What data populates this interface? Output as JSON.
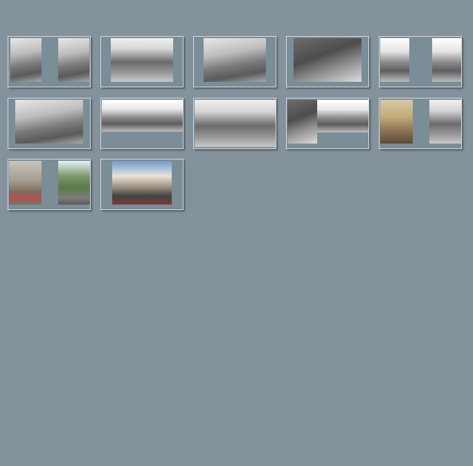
{
  "gallery": {
    "thumbnails": [
      {
        "caption": "",
        "palette": "bw"
      },
      {
        "caption": "",
        "palette": "bw2"
      },
      {
        "caption": "",
        "palette": "bw"
      },
      {
        "caption": "",
        "palette": "bw3"
      },
      {
        "caption": "",
        "palette": "bw4"
      },
      {
        "caption": "",
        "palette": "bw"
      },
      {
        "caption": "",
        "palette": "bw4"
      },
      {
        "caption": "",
        "palette": "bw2"
      },
      {
        "caption": "",
        "palette": "bw3"
      },
      {
        "caption": "",
        "palette": "col2"
      },
      {
        "caption": "",
        "palette": "col4"
      },
      {
        "caption": "",
        "palette": "col3"
      }
    ]
  },
  "colors": {
    "page_background": "#84929c",
    "thumbnail_frame": "#7b8d97",
    "thumbnail_border": "#d8dde0"
  }
}
